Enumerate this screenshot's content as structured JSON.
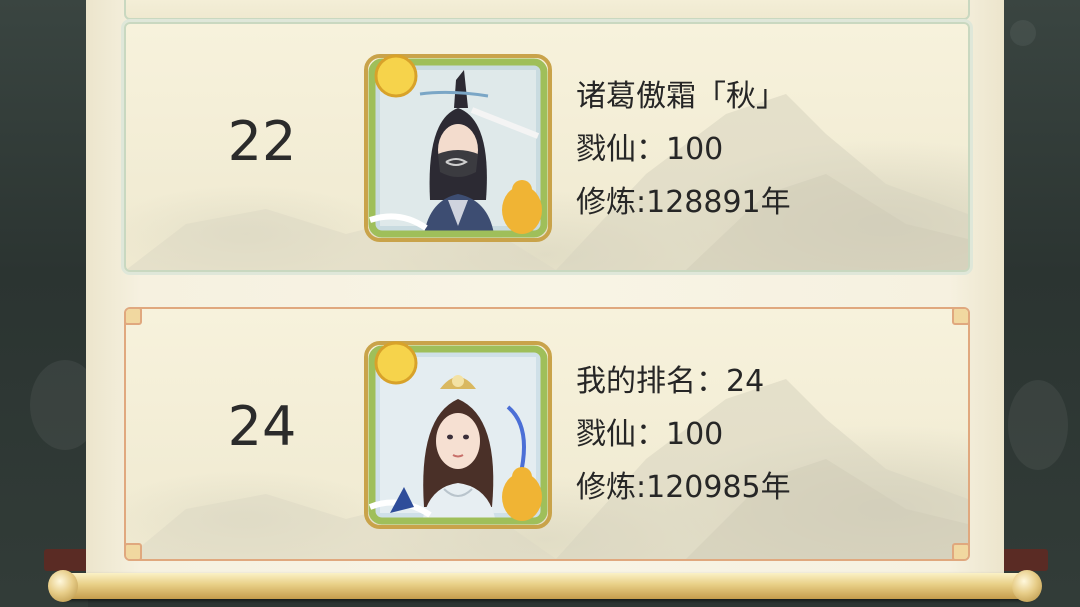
{
  "leaderboard": {
    "entries": [
      {
        "rank": "22",
        "name": "诸葛傲霜「秋」",
        "kill_line": "戮仙：100",
        "cultivation_line": "修炼:128891年"
      }
    ],
    "my_entry": {
      "rank": "24",
      "my_rank_line": "我的排名：24",
      "kill_line": "戮仙：100",
      "cultivation_line": "修炼:120985年"
    }
  },
  "colors": {
    "paper": "#f8f4e5",
    "card_border_highlight": "#e0a87e",
    "card_border_normal": "#c9d8c0",
    "text": "#262626"
  }
}
